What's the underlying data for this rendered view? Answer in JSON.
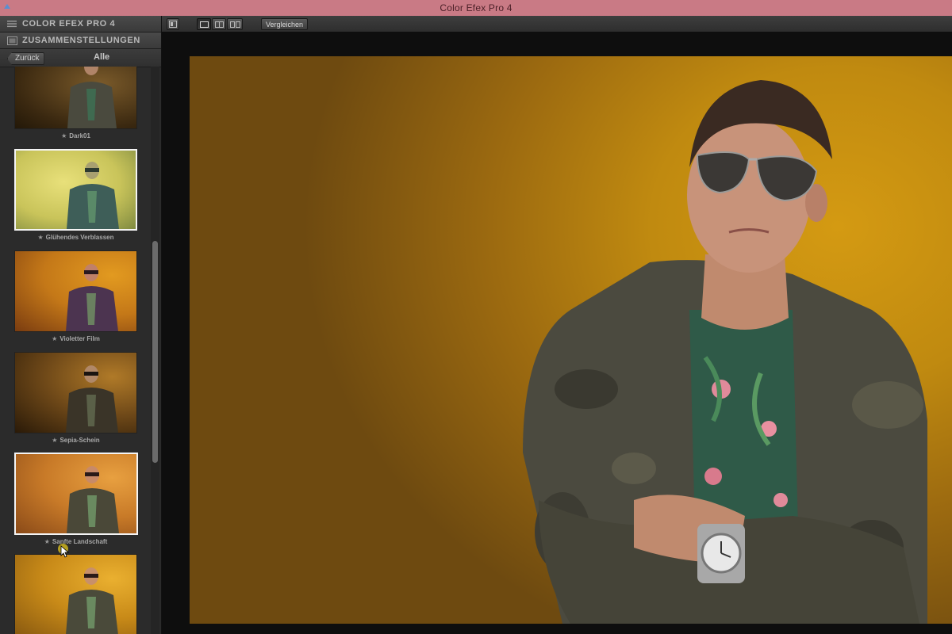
{
  "window": {
    "title": "Color Efex Pro 4"
  },
  "sidebar": {
    "product_title": "COLOR EFEX PRO 4",
    "section_title": "ZUSAMMENSTELLUNGEN",
    "back_label": "Zurück",
    "filter_label": "Alle",
    "presets": [
      {
        "label": "Dark01",
        "selected": false,
        "tone": "dark-brown"
      },
      {
        "label": "Glühendes Verblassen",
        "selected": true,
        "tone": "pale-yellow-green"
      },
      {
        "label": "Violetter Film",
        "selected": false,
        "tone": "orange-violet"
      },
      {
        "label": "Sepia-Schein",
        "selected": false,
        "tone": "dark-sepia"
      },
      {
        "label": "Sanfte Landschaft",
        "selected": true,
        "tone": "warm-orange"
      },
      {
        "label": "",
        "selected": false,
        "tone": "gold"
      }
    ],
    "star_glyph": "★"
  },
  "toolbar": {
    "compare_label": "Vergleichen",
    "view_modes": [
      "single-view-icon",
      "split-view-icon",
      "side-by-side-view-icon"
    ]
  },
  "colors": {
    "titlebar": "#c97a85",
    "panel": "#2b2b2b",
    "photo_background": "#c8900f"
  }
}
